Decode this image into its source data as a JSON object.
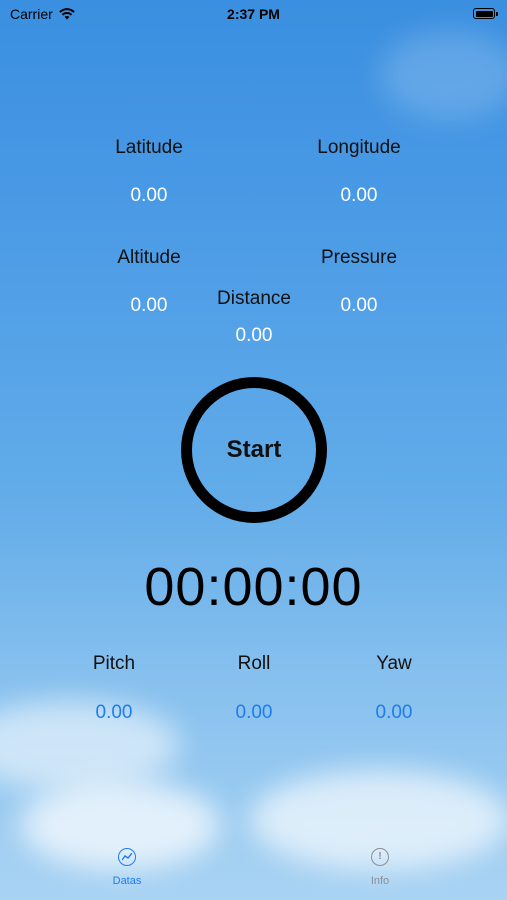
{
  "status": {
    "carrier": "Carrier",
    "time": "2:37 PM"
  },
  "location": {
    "latitude_label": "Latitude",
    "latitude_value": "0.00",
    "longitude_label": "Longitude",
    "longitude_value": "0.00",
    "altitude_label": "Altitude",
    "altitude_value": "0.00",
    "pressure_label": "Pressure",
    "pressure_value": "0.00",
    "distance_label": "Distance",
    "distance_value": "0.00"
  },
  "control": {
    "start_label": "Start",
    "timer": "00:00:00"
  },
  "motion": {
    "pitch_label": "Pitch",
    "pitch_value": "0.00",
    "roll_label": "Roll",
    "roll_value": "0.00",
    "yaw_label": "Yaw",
    "yaw_value": "0.00"
  },
  "tabs": [
    {
      "label": "Datas",
      "icon": "chart-icon",
      "active": true
    },
    {
      "label": "Info",
      "icon": "info-icon",
      "active": false
    }
  ],
  "colors": {
    "accent": "#1f7cf0",
    "inactive_tab": "#8a8f96"
  }
}
